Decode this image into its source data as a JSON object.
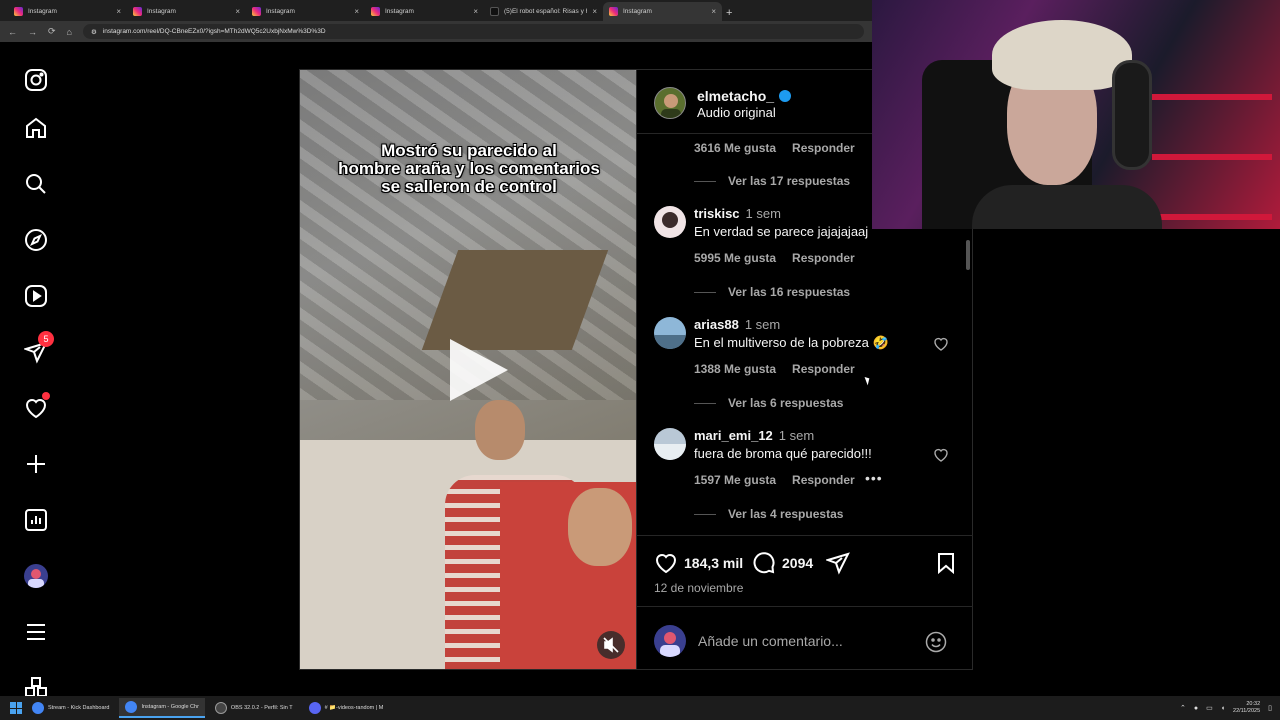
{
  "browser": {
    "tabs": [
      {
        "title": "Instagram",
        "icon": "instagram-icon",
        "active": false
      },
      {
        "title": "Instagram",
        "icon": "instagram-icon",
        "active": false
      },
      {
        "title": "Instagram",
        "icon": "instagram-icon",
        "active": false
      },
      {
        "title": "Instagram",
        "icon": "instagram-icon",
        "active": false
      },
      {
        "title": "(5)El robot español: Risas y hum",
        "icon": "tiktok-icon",
        "active": false
      },
      {
        "title": "Instagram",
        "icon": "instagram-icon",
        "active": true
      }
    ],
    "new_tab": "+",
    "close": "×",
    "url": "instagram.com/reel/DQ-CBneEZx0/?igsh=MTh2dWQ5c2UxbjNxMw%3D%3D"
  },
  "sidebar": {
    "items": [
      {
        "name": "instagram-logo-icon"
      },
      {
        "name": "home-icon"
      },
      {
        "name": "search-icon"
      },
      {
        "name": "explore-icon"
      },
      {
        "name": "reels-icon"
      },
      {
        "name": "messages-icon",
        "badge": "5"
      },
      {
        "name": "notifications-icon",
        "dot": true
      },
      {
        "name": "create-icon"
      },
      {
        "name": "dashboard-icon"
      },
      {
        "name": "profile-icon"
      },
      {
        "name": "menu-icon"
      },
      {
        "name": "more-apps-icon"
      }
    ]
  },
  "video": {
    "caption_line1": "Mostró su parecido al",
    "caption_line2": "hombre araña y los comentarios",
    "caption_line3": "se salleron de control"
  },
  "post": {
    "username": "elmetacho_",
    "audio": "Audio original",
    "comments": [
      {
        "likes": "3616 Me gusta",
        "reply": "Responder",
        "replies": "Ver las 17 respuestas"
      },
      {
        "user": "triskisc",
        "time": "1 sem",
        "text": "En verdad se parece jajajajaaj",
        "likes": "5995 Me gusta",
        "reply": "Responder",
        "replies": "Ver las 16 respuestas"
      },
      {
        "user": "arias88",
        "time": "1 sem",
        "text": "En el multiverso de la pobreza 🤣",
        "likes": "1388 Me gusta",
        "reply": "Responder",
        "replies": "Ver las 6 respuestas"
      },
      {
        "user": "mari_emi_12",
        "time": "1 sem",
        "text": "fuera de broma qué parecido!!!",
        "likes": "1597 Me gusta",
        "reply": "Responder",
        "more": "•••",
        "replies": "Ver las 4 respuestas"
      }
    ],
    "like_count": "184,3 mil",
    "comment_count": "2094",
    "date": "12 de noviembre",
    "add_comment_placeholder": "Añade un comentario..."
  },
  "taskbar": {
    "items": [
      {
        "label": "Stream - Kick Dashboard",
        "color": "#4285f4"
      },
      {
        "label": "Instagram - Google Chr",
        "color": "#4285f4",
        "active": true
      },
      {
        "label": "OBS 32.0.2 - Perfil: Sin T",
        "color": "#444444"
      },
      {
        "label": "# 📁-videos-random | M",
        "color": "#5865f2"
      }
    ],
    "time": "20:32",
    "date": "22/11/2025"
  }
}
